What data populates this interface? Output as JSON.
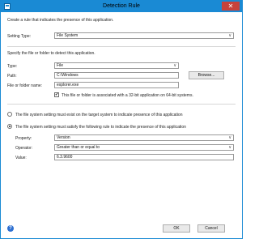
{
  "window": {
    "title": "Detection Rule",
    "close_glyph": "✕"
  },
  "intro": {
    "text": "Create a rule that indicates the presence of this application."
  },
  "setting_type": {
    "label": "Setting Type:",
    "value": "File System"
  },
  "file_section": {
    "heading": "Specify the file or folder to detect this application.",
    "type_label": "Type:",
    "type_value": "File",
    "path_label": "Path:",
    "path_value": "C:\\Windows",
    "browse_label": "Browse...",
    "name_label": "File or folder name:",
    "name_value": "explorer.exe",
    "checkbox_label": "This file or folder is associated with a 32-bit application on 64-bit systems.",
    "checkbox_checked": true,
    "check_glyph": "✔"
  },
  "rule": {
    "radio_exist_label": "The file system setting must exist on the target system to indicate presence of this application",
    "radio_rule_label": "The file system setting must satisfy the following rule to indicate the presence of this application",
    "selected": "rule",
    "property_label": "Property:",
    "property_value": "Version",
    "operator_label": "Operator:",
    "operator_value": "Greater than or equal to",
    "value_label": "Value:",
    "value_value": "6.3.9600"
  },
  "footer": {
    "help_glyph": "?",
    "ok_label": "OK",
    "cancel_label": "Cancel"
  },
  "icons": {
    "chevron": "∨"
  }
}
